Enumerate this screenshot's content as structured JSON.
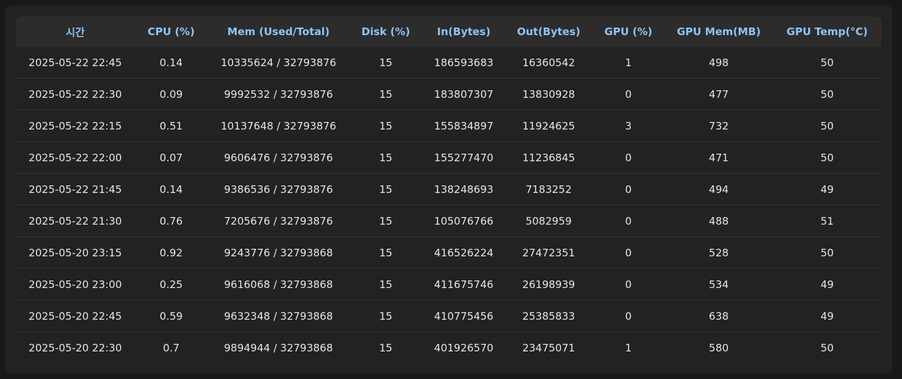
{
  "table": {
    "columns": [
      "시간",
      "CPU (%)",
      "Mem (Used/Total)",
      "Disk (%)",
      "In(Bytes)",
      "Out(Bytes)",
      "GPU (%)",
      "GPU Mem(MB)",
      "GPU Temp(°C)"
    ],
    "rows": [
      [
        "2025-05-22 22:45",
        "0.14",
        "10335624 / 32793876",
        "15",
        "186593683",
        "16360542",
        "1",
        "498",
        "50"
      ],
      [
        "2025-05-22 22:30",
        "0.09",
        "9992532 / 32793876",
        "15",
        "183807307",
        "13830928",
        "0",
        "477",
        "50"
      ],
      [
        "2025-05-22 22:15",
        "0.51",
        "10137648 / 32793876",
        "15",
        "155834897",
        "11924625",
        "3",
        "732",
        "50"
      ],
      [
        "2025-05-22 22:00",
        "0.07",
        "9606476 / 32793876",
        "15",
        "155277470",
        "11236845",
        "0",
        "471",
        "50"
      ],
      [
        "2025-05-22 21:45",
        "0.14",
        "9386536 / 32793876",
        "15",
        "138248693",
        "7183252",
        "0",
        "494",
        "49"
      ],
      [
        "2025-05-22 21:30",
        "0.76",
        "7205676 / 32793876",
        "15",
        "105076766",
        "5082959",
        "0",
        "488",
        "51"
      ],
      [
        "2025-05-20 23:15",
        "0.92",
        "9243776 / 32793868",
        "15",
        "416526224",
        "27472351",
        "0",
        "528",
        "50"
      ],
      [
        "2025-05-20 23:00",
        "0.25",
        "9616068 / 32793868",
        "15",
        "411675746",
        "26198939",
        "0",
        "534",
        "49"
      ],
      [
        "2025-05-20 22:45",
        "0.59",
        "9632348 / 32793868",
        "15",
        "410775456",
        "25385833",
        "0",
        "638",
        "49"
      ],
      [
        "2025-05-20 22:30",
        "0.7",
        "9894944 / 32793868",
        "15",
        "401926570",
        "23475071",
        "1",
        "580",
        "50"
      ]
    ]
  },
  "colors": {
    "page_background": "#181818",
    "panel_background": "#222222",
    "header_background": "#2c2c2c",
    "header_text": "#8ec3f5",
    "cell_text": "#e6e6e6",
    "row_divider": "#343434"
  }
}
